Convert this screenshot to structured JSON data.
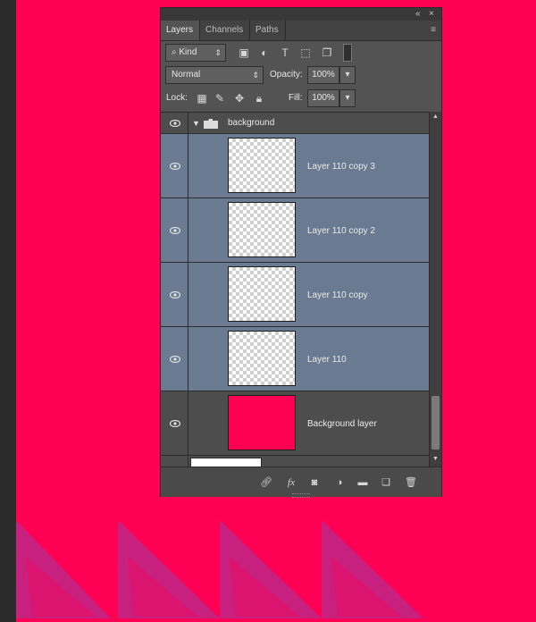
{
  "panel": {
    "tabs": [
      {
        "label": "Layers"
      },
      {
        "label": "Channels"
      },
      {
        "label": "Paths"
      }
    ],
    "filter": {
      "label": "Kind"
    },
    "blend": {
      "mode": "Normal"
    },
    "opacity": {
      "label": "Opacity:",
      "value": "100%"
    },
    "lock": {
      "label": "Lock:"
    },
    "fill": {
      "label": "Fill:",
      "value": "100%"
    },
    "group": {
      "name": "background"
    },
    "layers": [
      {
        "name": "Layer 110 copy 3",
        "thumb": "checker",
        "selected": true
      },
      {
        "name": "Layer 110 copy 2",
        "thumb": "checker",
        "selected": true
      },
      {
        "name": "Layer 110 copy",
        "thumb": "checker",
        "selected": true
      },
      {
        "name": "Layer 110",
        "thumb": "checker",
        "selected": true
      },
      {
        "name": "Background layer",
        "thumb": "solid",
        "selected": false
      }
    ]
  },
  "colors": {
    "canvas": "#ff0055",
    "triangle": "#c8207e",
    "selected_row": "#6a7a90",
    "panel": "#535353"
  }
}
